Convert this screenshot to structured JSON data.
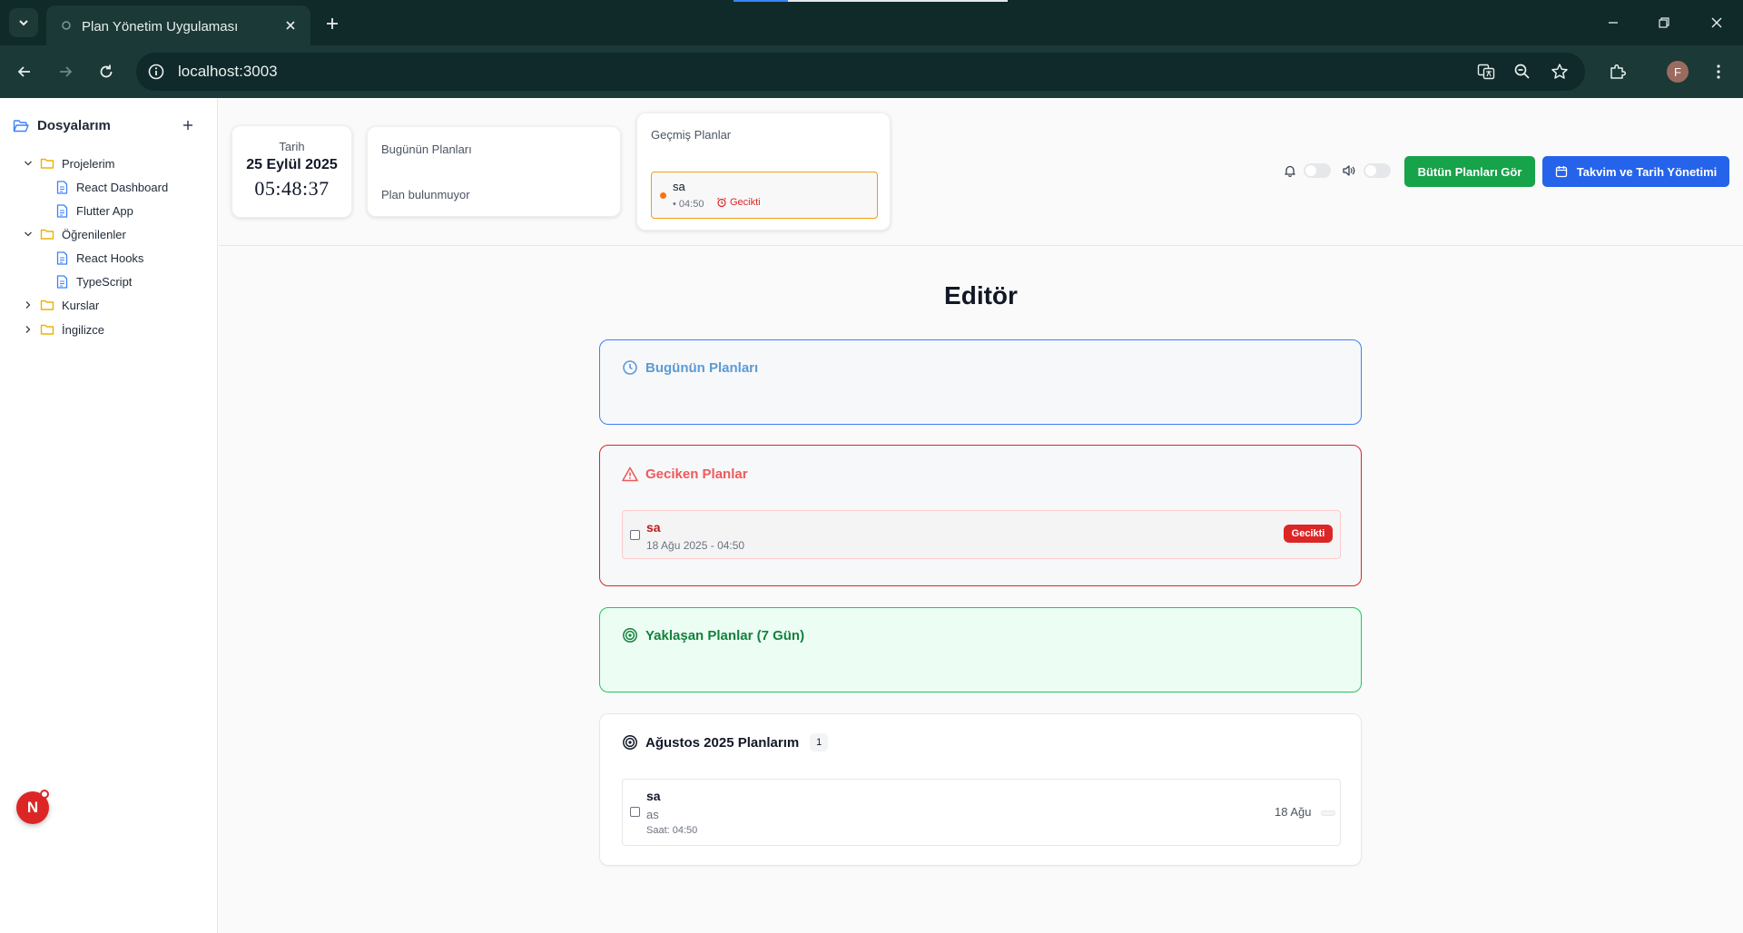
{
  "browser": {
    "tab_title": "Plan Yönetim Uygulaması",
    "url": "localhost:3003",
    "profile_initial": "F"
  },
  "sidebar": {
    "title": "Dosyalarım",
    "tree": [
      {
        "label": "Projelerim",
        "type": "folder",
        "expanded": true
      },
      {
        "label": "React Dashboard",
        "type": "file"
      },
      {
        "label": "Flutter App",
        "type": "file"
      },
      {
        "label": "Öğrenilenler",
        "type": "folder",
        "expanded": true
      },
      {
        "label": "React Hooks",
        "type": "file"
      },
      {
        "label": "TypeScript",
        "type": "file"
      },
      {
        "label": "Kurslar",
        "type": "folder",
        "expanded": false
      },
      {
        "label": "İngilizce",
        "type": "folder",
        "expanded": false
      }
    ],
    "badge": "N"
  },
  "header": {
    "date_card": {
      "label": "Tarih",
      "date": "25 Eylül 2025",
      "time": "05:48:37"
    },
    "today_card": {
      "title": "Bugünün Planları",
      "empty": "Plan bulunmuyor"
    },
    "past_card": {
      "title": "Geçmiş Planlar",
      "item": {
        "name": "sa",
        "time": "• 04:50",
        "status": "Gecikti"
      }
    },
    "buttons": {
      "all_plans": "Bütün Planları Gör",
      "calendar": "Takvim ve Tarih Yönetimi"
    }
  },
  "editor": {
    "title": "Editör",
    "today": {
      "title": "Bugünün Planları"
    },
    "late": {
      "title": "Geciken Planlar",
      "item": {
        "name": "sa",
        "datetime": "18 Ağu 2025 - 04:50",
        "badge": "Gecikti"
      }
    },
    "upcoming": {
      "title": "Yaklaşan Planlar (7 Gün)"
    },
    "month": {
      "title": "Ağustos 2025 Planlarım",
      "count": "1",
      "item": {
        "name": "sa",
        "description": "as",
        "time": "Saat: 04:50",
        "date": "18 Ağu"
      }
    }
  },
  "colors": {
    "browser_dark": "#0f2a28",
    "green": "#16a34a",
    "blue": "#2563eb",
    "red": "#dc2626",
    "folder": "#eab308"
  }
}
